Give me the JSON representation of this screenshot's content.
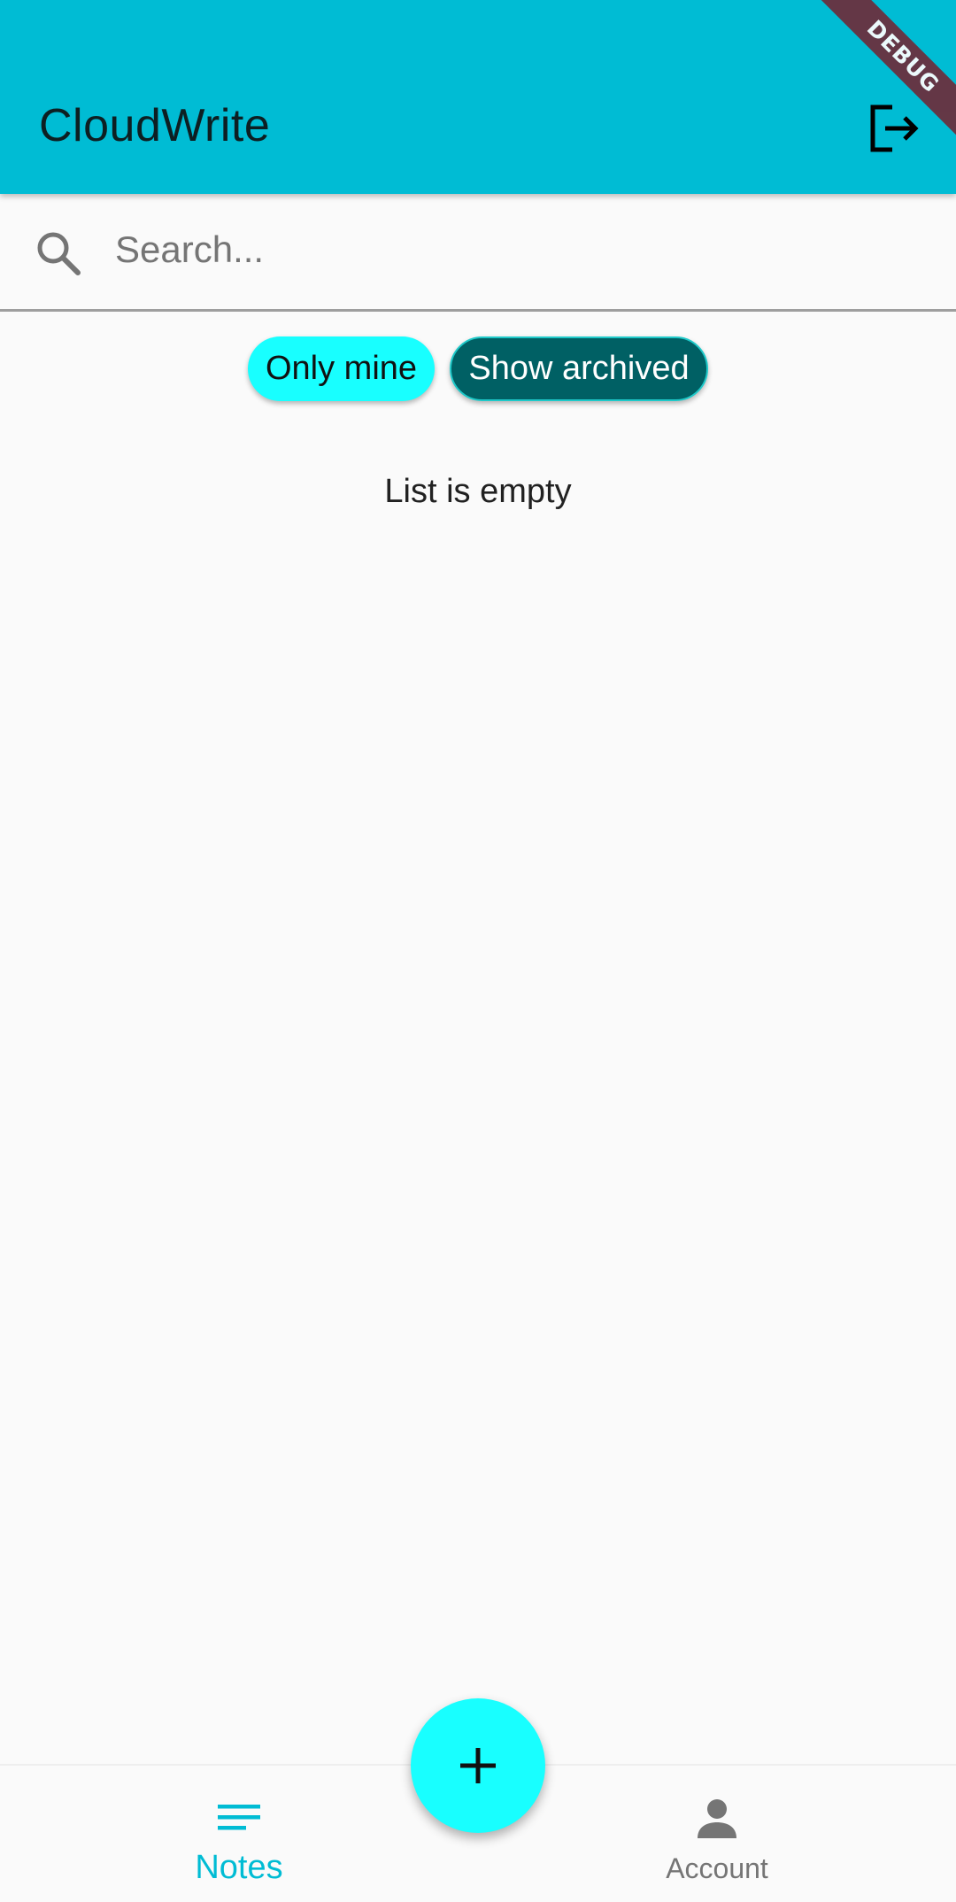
{
  "appbar": {
    "title": "CloudWrite",
    "logout_icon": "logout-icon",
    "background_color": "#00bcd4"
  },
  "debug_banner": "DEBUG",
  "search": {
    "placeholder": "Search...",
    "value": "",
    "icon": "search-icon"
  },
  "filters": {
    "only_mine": "Only mine",
    "show_archived": "Show archived"
  },
  "main": {
    "empty_message": "List is empty"
  },
  "fab": {
    "icon": "plus-icon",
    "color": "#18ffff"
  },
  "bottom_nav": {
    "items": [
      {
        "label": "Notes",
        "icon": "notes-icon",
        "selected": true
      },
      {
        "label": "Account",
        "icon": "account-icon",
        "selected": false
      }
    ],
    "selected_color": "#00bcd4",
    "unselected_color": "#757575"
  }
}
